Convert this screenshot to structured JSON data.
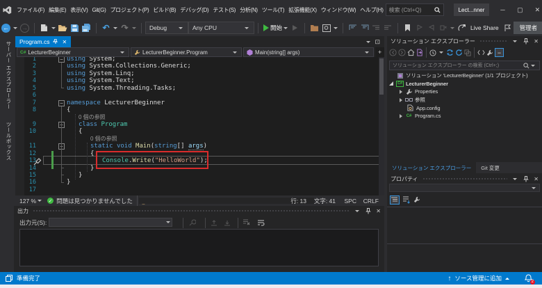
{
  "titlebar": {
    "menu": [
      "ファイル(F)",
      "編集(E)",
      "表示(V)",
      "Git(G)",
      "プロジェクト(P)",
      "ビルド(B)",
      "デバッグ(D)",
      "テスト(S)",
      "分析(N)",
      "ツール(T)",
      "拡張機能(X)",
      "ウィンドウ(W)",
      "ヘルプ(H)"
    ],
    "search_placeholder": "検索 (Ctrl+Q)",
    "window_title": "Lect...nner"
  },
  "toolbar": {
    "config": "Debug",
    "platform": "Any CPU",
    "start": "開始",
    "live_share": "Live Share",
    "admin": "管理者"
  },
  "side_tabs": [
    "サーバー エクスプローラー",
    "ツールボックス"
  ],
  "editor": {
    "tab": "Program.cs",
    "nav": [
      "LecturerBeginner",
      "LecturerBeginner.Program",
      "Main(string[] args)"
    ],
    "rows": [
      {
        "n": "1",
        "fold": true,
        "ind": 0,
        "seg": [
          [
            "k",
            "using"
          ],
          [
            "i",
            " System;"
          ]
        ]
      },
      {
        "n": "2",
        "ind": 0,
        "seg": [
          [
            "k",
            "using"
          ],
          [
            "i",
            " System.Collections.Generic;"
          ]
        ]
      },
      {
        "n": "3",
        "ind": 0,
        "seg": [
          [
            "k",
            "using"
          ],
          [
            "i",
            " System.Linq;"
          ]
        ]
      },
      {
        "n": "4",
        "ind": 0,
        "seg": [
          [
            "k",
            "using"
          ],
          [
            "i",
            " System.Text;"
          ]
        ]
      },
      {
        "n": "5",
        "ind": 0,
        "seg": [
          [
            "k",
            "using"
          ],
          [
            "i",
            " System.Threading.Tasks;"
          ]
        ]
      },
      {
        "n": "6",
        "ind": 0,
        "seg": []
      },
      {
        "n": "7",
        "fold": true,
        "ind": 0,
        "seg": [
          [
            "k",
            "namespace"
          ],
          [
            "i",
            " LecturerBeginner"
          ]
        ]
      },
      {
        "n": "8",
        "ind": 0,
        "seg": [
          [
            "i",
            "{"
          ]
        ]
      },
      {
        "lens": true,
        "ind": 1,
        "seg": [
          [
            "lens",
            "0 個の参照"
          ]
        ]
      },
      {
        "n": "9",
        "fold": true,
        "ind": 1,
        "seg": [
          [
            "k",
            "class"
          ],
          [
            "i",
            " "
          ],
          [
            "t",
            "Program"
          ]
        ]
      },
      {
        "n": "10",
        "ind": 1,
        "seg": [
          [
            "i",
            "{"
          ]
        ]
      },
      {
        "lens": true,
        "ind": 2,
        "seg": [
          [
            "lens",
            "0 個の参照"
          ]
        ]
      },
      {
        "n": "11",
        "fold": true,
        "ind": 2,
        "seg": [
          [
            "k",
            "static"
          ],
          [
            "i",
            " "
          ],
          [
            "k",
            "void"
          ],
          [
            "i",
            " "
          ],
          [
            "m",
            "Main"
          ],
          [
            "i",
            "("
          ],
          [
            "k",
            "string"
          ],
          [
            "i",
            "[] "
          ],
          [
            "p",
            "args"
          ],
          [
            "i",
            ")"
          ]
        ]
      },
      {
        "n": "12",
        "ind": 2,
        "seg": [
          [
            "i",
            "{"
          ]
        ]
      },
      {
        "n": "13",
        "cur": true,
        "ind": 3,
        "seg": [
          [
            "t",
            "Console"
          ],
          [
            "i",
            "."
          ],
          [
            "m",
            "Write"
          ],
          [
            "i",
            "("
          ],
          [
            "s",
            "\"HelloWorld\""
          ],
          [
            "i",
            ");"
          ]
        ]
      },
      {
        "n": "14",
        "ind": 2,
        "seg": [
          [
            "i",
            "}"
          ]
        ]
      },
      {
        "n": "15",
        "ind": 1,
        "seg": [
          [
            "i",
            "}"
          ]
        ]
      },
      {
        "n": "16",
        "ind": 0,
        "seg": [
          [
            "i",
            "}"
          ]
        ]
      },
      {
        "n": "17",
        "ind": 0,
        "seg": []
      }
    ],
    "status": {
      "zoom": "127 %",
      "health": "問題は見つかりませんでした",
      "line": "行: 13",
      "col": "文字: 41",
      "ins": "SPC",
      "eol": "CRLF"
    }
  },
  "output": {
    "title": "出力",
    "source_label": "出力元(S):"
  },
  "solution": {
    "title": "ソリューション エクスプローラー",
    "search_placeholder": "ソリューション エクスプローラー の検索 (Ctrl+;)",
    "tree": [
      {
        "icon": "solution",
        "label": "ソリューション 'LecturerBeginner' (1/1 プロジェクト)",
        "ind": 0,
        "arrow": ""
      },
      {
        "icon": "csproj",
        "label": "LecturerBeginner",
        "ind": 0,
        "arrow": "open",
        "bold": true
      },
      {
        "icon": "wrench",
        "label": "Properties",
        "ind": 1,
        "arrow": "closed"
      },
      {
        "icon": "refs",
        "label": "参照",
        "ind": 1,
        "arrow": "closed"
      },
      {
        "icon": "config",
        "label": "App.config",
        "ind": 1,
        "arrow": ""
      },
      {
        "icon": "cs",
        "label": "Program.cs",
        "ind": 1,
        "arrow": "closed"
      }
    ],
    "tabs": [
      "ソリューション エクスプローラー",
      "Git 変更"
    ]
  },
  "properties": {
    "title": "プロパティ"
  },
  "statusbar": {
    "ready": "準備完了",
    "add_source_control": "ソース管理に追加",
    "notification_count": "2"
  }
}
